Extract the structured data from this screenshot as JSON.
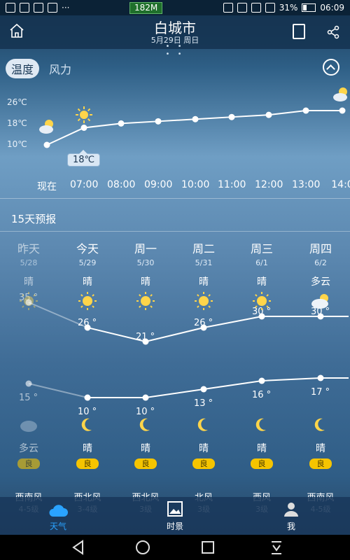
{
  "status_bar": {
    "data_speed": "182M",
    "battery": "31%",
    "time": "06:09"
  },
  "header": {
    "city": "白城市",
    "date": "5月29日 周日",
    "dots": "• • • •"
  },
  "tabs": {
    "active": "温度",
    "inactive": "风力"
  },
  "hourly": {
    "y_labels": [
      "26℃",
      "18℃",
      "10℃"
    ],
    "times": [
      "现在",
      "07:00",
      "08:00",
      "09:00",
      "10:00",
      "11:00",
      "12:00",
      "13:00",
      "14:0"
    ],
    "tooltip": "18℃",
    "temps": [
      10,
      18,
      20,
      21,
      22,
      23,
      24,
      26,
      26
    ],
    "y_range": [
      10,
      26
    ]
  },
  "forecast": {
    "title": "15天预报",
    "days": [
      {
        "name": "昨天",
        "date": "5/28",
        "day_cond": "晴",
        "night_cond": "多云",
        "aqi": "良",
        "high_label": "35 °",
        "low_label": "15 °",
        "high": 35,
        "low": 15,
        "day_icon": "sun-icon",
        "night_icon": "cloudy-night-icon",
        "past": true
      },
      {
        "name": "今天",
        "date": "5/29",
        "day_cond": "晴",
        "night_cond": "晴",
        "aqi": "良",
        "high_label": "26 °",
        "low_label": "10 °",
        "high": 26,
        "low": 10,
        "day_icon": "sun-icon",
        "night_icon": "moon-icon",
        "past": false
      },
      {
        "name": "周一",
        "date": "5/30",
        "day_cond": "晴",
        "night_cond": "晴",
        "aqi": "良",
        "high_label": "21 °",
        "low_label": "10 °",
        "high": 21,
        "low": 10,
        "day_icon": "sun-icon",
        "night_icon": "moon-icon",
        "past": false
      },
      {
        "name": "周二",
        "date": "5/31",
        "day_cond": "晴",
        "night_cond": "晴",
        "aqi": "良",
        "high_label": "26 °",
        "low_label": "13 °",
        "high": 26,
        "low": 13,
        "day_icon": "sun-icon",
        "night_icon": "moon-icon",
        "past": false
      },
      {
        "name": "周三",
        "date": "6/1",
        "day_cond": "晴",
        "night_cond": "晴",
        "aqi": "良",
        "high_label": "30 °",
        "low_label": "16 °",
        "high": 30,
        "low": 16,
        "day_icon": "sun-icon",
        "night_icon": "moon-icon",
        "past": false
      },
      {
        "name": "周四",
        "date": "6/2",
        "day_cond": "多云",
        "night_cond": "晴",
        "aqi": "良",
        "high_label": "30 °",
        "low_label": "17 °",
        "high": 30,
        "low": 17,
        "day_icon": "cloudy-icon",
        "night_icon": "moon-icon",
        "past": false
      }
    ]
  },
  "wind": [
    {
      "dir": "西南风",
      "level": "4-5级"
    },
    {
      "dir": "西北风",
      "level": "3-4级"
    },
    {
      "dir": "西北风",
      "level": "3级"
    },
    {
      "dir": "北风",
      "level": "3级"
    },
    {
      "dir": "西风",
      "level": "3级"
    },
    {
      "dir": "西南风",
      "level": "4-5级"
    }
  ],
  "bottom_nav": [
    {
      "label": "天气",
      "icon": "cloud-icon",
      "active": true
    },
    {
      "label": "时景",
      "icon": "image-icon",
      "active": false
    },
    {
      "label": "我",
      "icon": "person-icon",
      "active": false
    }
  ],
  "colors": {
    "accent": "#2aa3ff",
    "aqi_badge": "#f5c400"
  }
}
